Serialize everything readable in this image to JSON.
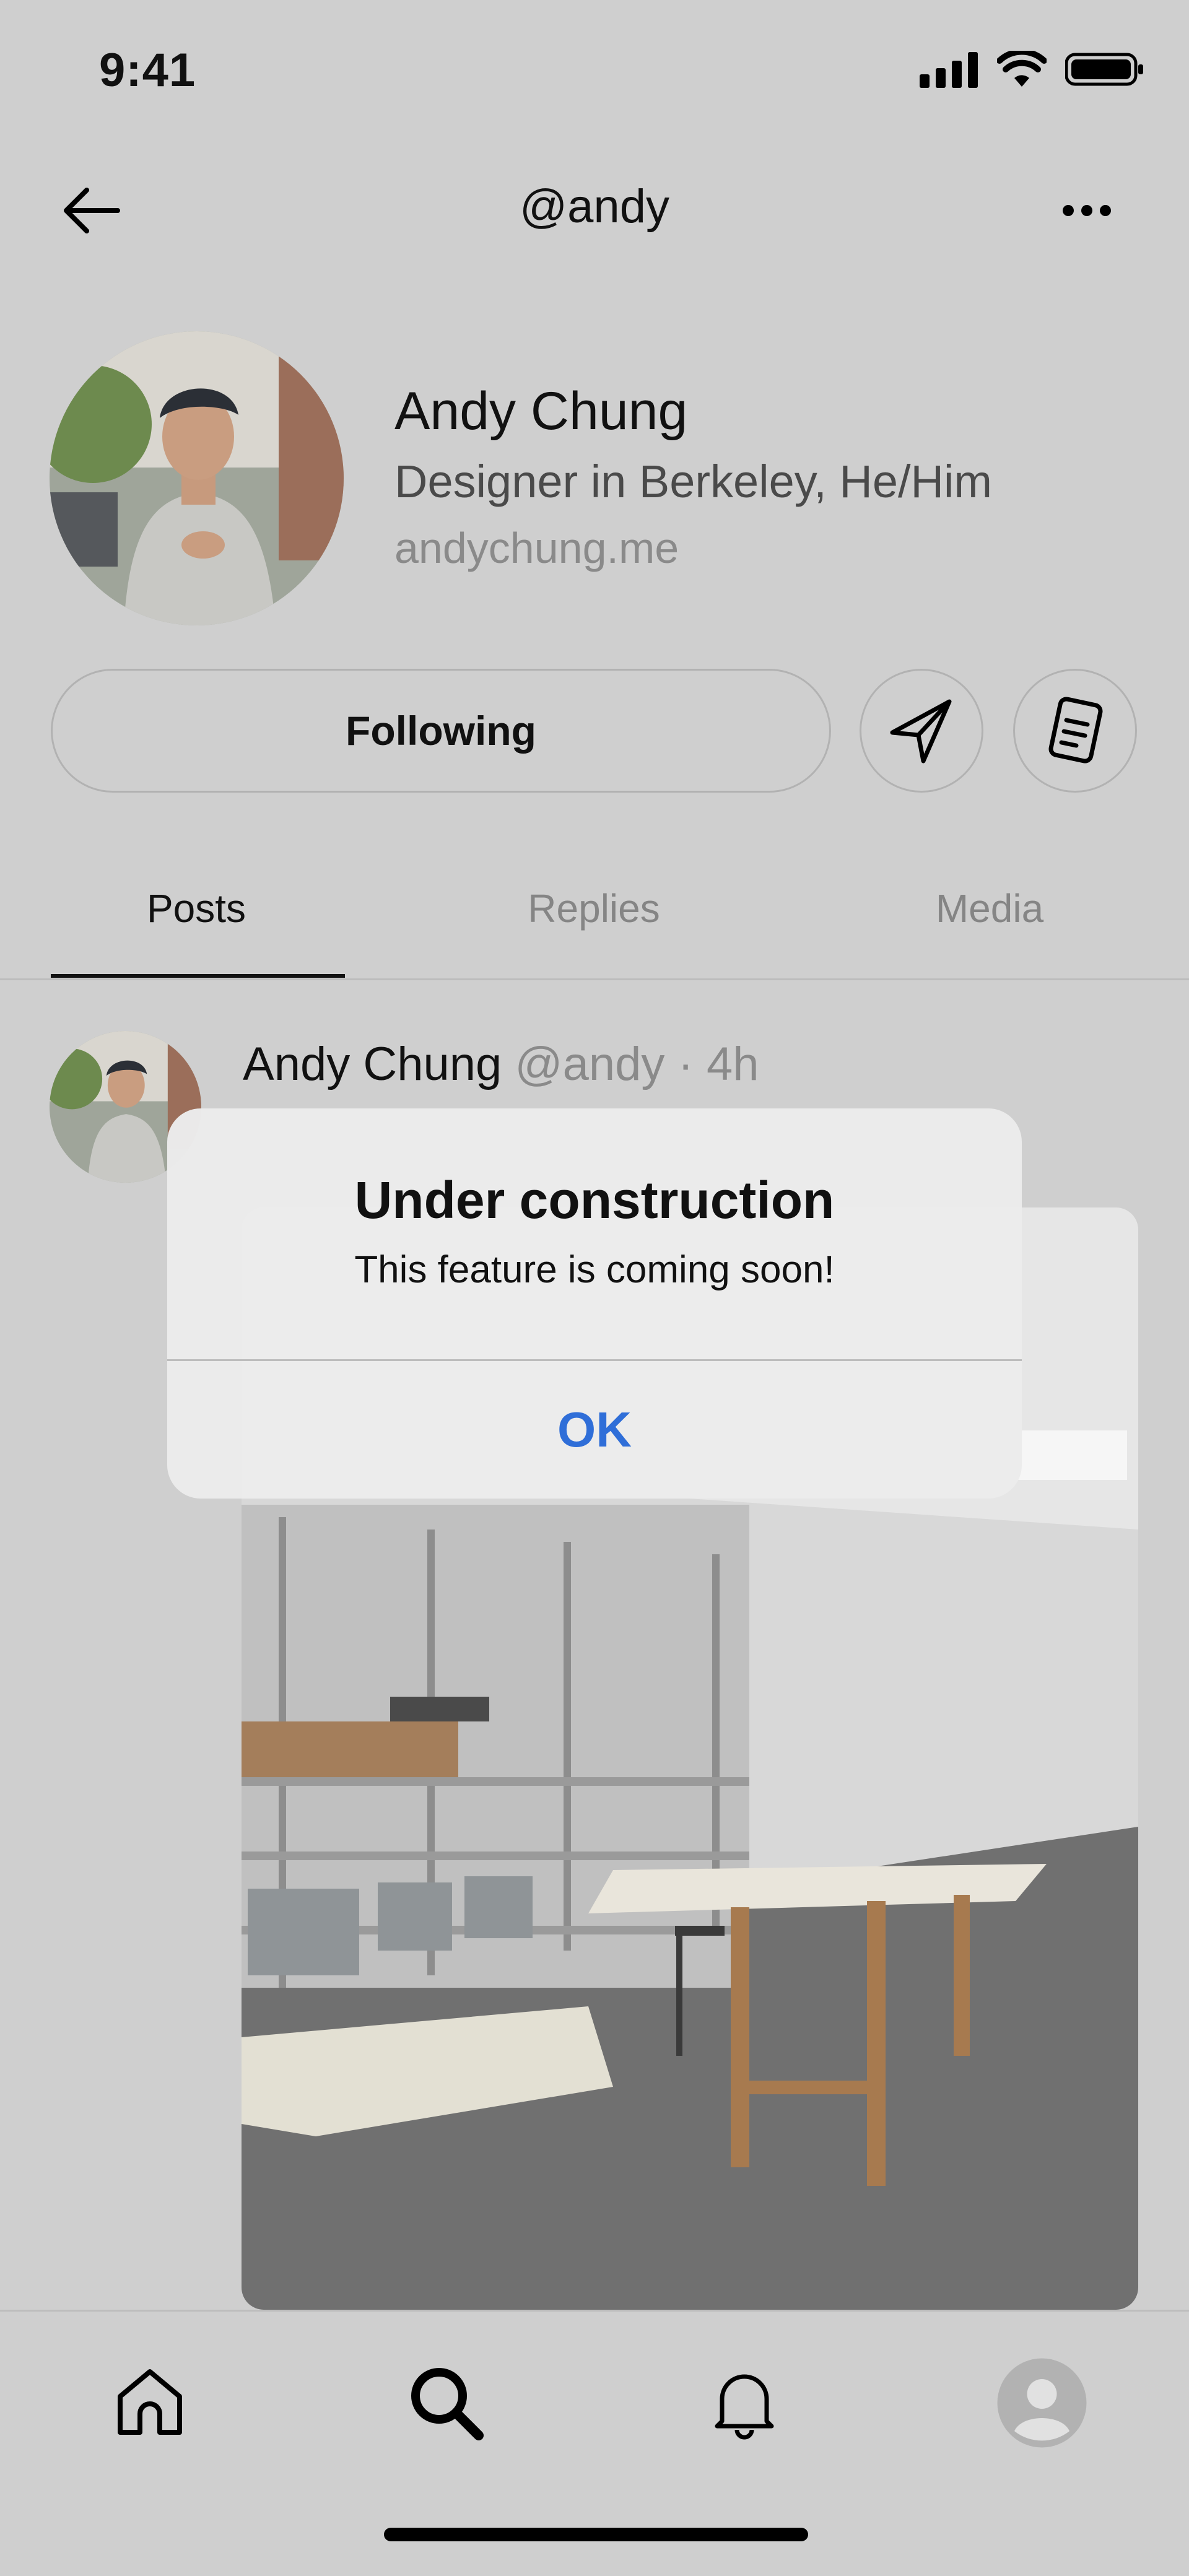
{
  "status_bar": {
    "time": "9:41"
  },
  "nav": {
    "title": "@andy"
  },
  "profile": {
    "name": "Andy Chung",
    "bio": "Designer in Berkeley, He/Him",
    "link": "andychung.me",
    "following_label": "Following"
  },
  "tabs": [
    {
      "label": "Posts",
      "active": true
    },
    {
      "label": "Replies",
      "active": false
    },
    {
      "label": "Media",
      "active": false
    }
  ],
  "post": {
    "author": "Andy Chung",
    "handle": "@andy",
    "separator": "·",
    "time": "4h"
  },
  "dialog": {
    "title": "Under construction",
    "message": "This feature is coming soon!",
    "ok_label": "OK"
  },
  "colors": {
    "accent": "#2f6ed8",
    "background": "#cfcfcf"
  },
  "icons": {
    "back": "arrow-left-icon",
    "more": "ellipsis-icon",
    "send": "paper-plane-icon",
    "notes": "document-icon",
    "home": "home-icon",
    "search": "search-icon",
    "notifications": "bell-icon",
    "profile": "user-avatar-icon"
  }
}
